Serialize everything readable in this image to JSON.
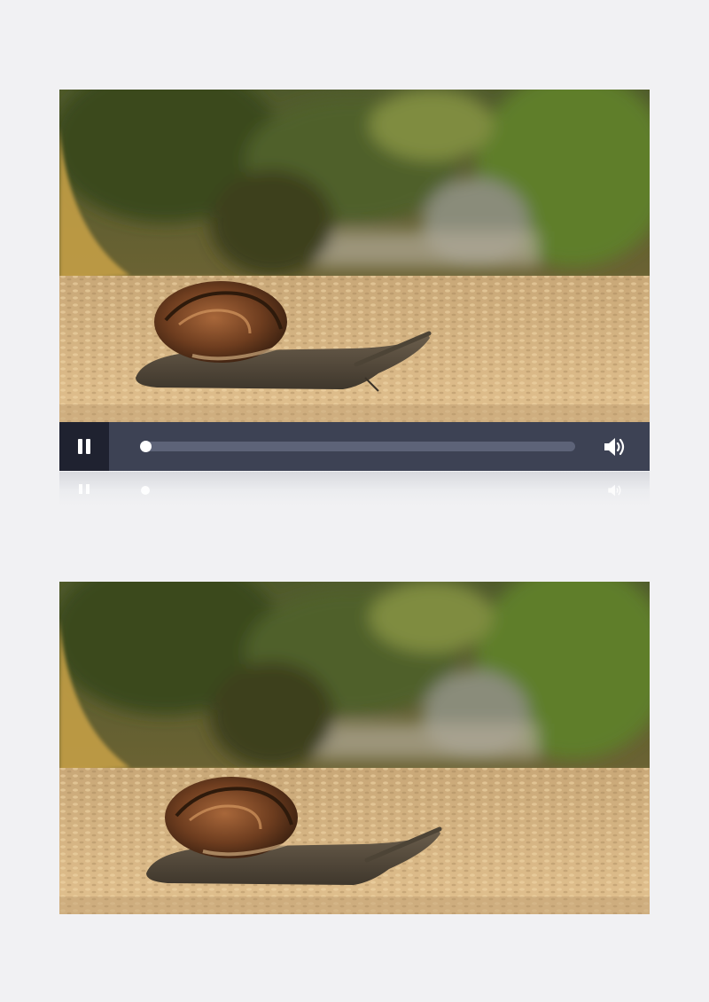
{
  "player": {
    "progress_percent": 0,
    "state": "playing",
    "pause_icon": "pause-icon",
    "volume_icon": "volume-icon",
    "colors": {
      "control_bar": "#3d4254",
      "pause_background": "#1f2230",
      "track": "#5d6378",
      "thumb": "#ffffff"
    }
  }
}
